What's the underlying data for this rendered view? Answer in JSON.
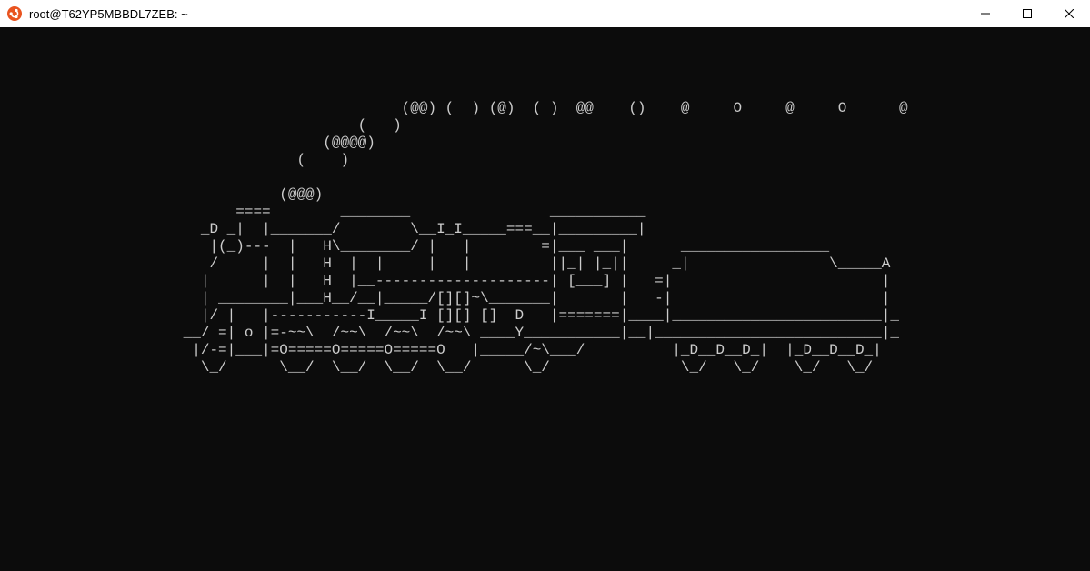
{
  "window": {
    "title": "root@T62YP5MBBDL7ZEB: ~",
    "icon_name": "ubuntu-icon"
  },
  "terminal": {
    "ascii_art": "\n\n\n\n                                              (@@) (  ) (@)  ( )  @@    ()    @     O     @     O      @\n                                         (   )\n                                     (@@@@)\n                                  (    )\n\n                                (@@@)\n                           ====        ________                ___________\n                       _D _|  |_______/        \\__I_I_____===__|_________|\n                        |(_)---  |   H\\________/ |   |        =|___ ___|      _________________\n                        /     |  |   H  |  |     |   |         ||_| |_||     _|                \\_____A\n                       |      |  |   H  |__--------------------| [___] |   =|                        |\n                       | ________|___H__/__|_____/[][]~\\_______|       |   -|                        |\n                       |/ |   |-----------I_____I [][] []  D   |=======|____|________________________|_\n                     __/ =| o |=-~~\\  /~~\\  /~~\\  /~~\\ ____Y___________|__|__________________________|_\n                      |/-=|___|=O=====O=====O=====O   |_____/~\\___/          |_D__D__D_|  |_D__D__D_|\n                       \\_/      \\__/  \\__/  \\__/  \\__/      \\_/               \\_/   \\_/    \\_/   \\_/"
  }
}
